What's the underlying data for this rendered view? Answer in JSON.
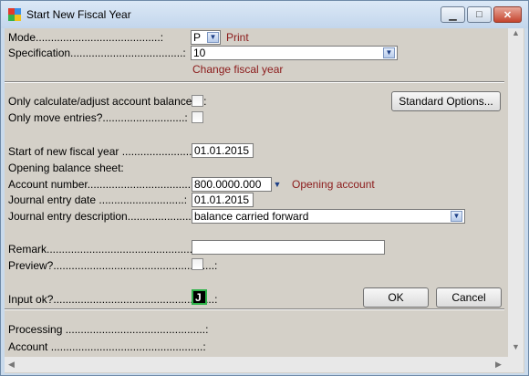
{
  "window": {
    "title": "Start New Fiscal Year"
  },
  "mode": {
    "label": "Mode",
    "value": "P",
    "hint": "Print"
  },
  "specification": {
    "label": "Specification",
    "value": "10",
    "hint": "Change fiscal year"
  },
  "only_calc": {
    "label": "Only calculate/adjust account balances?:"
  },
  "only_move": {
    "label": "Only move entries?"
  },
  "standard_options": {
    "label": "Standard Options..."
  },
  "start_fy": {
    "label": "Start of new fiscal year",
    "value": "01.01.2015"
  },
  "opening_sheet": {
    "label": "Opening balance sheet:"
  },
  "account_number": {
    "label": "Account number",
    "value": "800.0000.000",
    "hint": "Opening account"
  },
  "journal_date": {
    "label": "Journal entry date",
    "value": "01.01.2015"
  },
  "journal_desc": {
    "label": "Journal entry description",
    "value": "balance carried forward"
  },
  "remark": {
    "label": "Remark",
    "value": ""
  },
  "preview": {
    "label": "Preview?"
  },
  "input_ok": {
    "label": "Input ok?",
    "value": "J"
  },
  "buttons": {
    "ok": "OK",
    "cancel": "Cancel"
  },
  "processing": {
    "label": "Processing"
  },
  "account": {
    "label": "Account"
  },
  "icons": {
    "minimize": "minimize-icon",
    "maximize": "maximize-icon",
    "close": "close-icon",
    "dropdown": "chevron-down-icon"
  }
}
